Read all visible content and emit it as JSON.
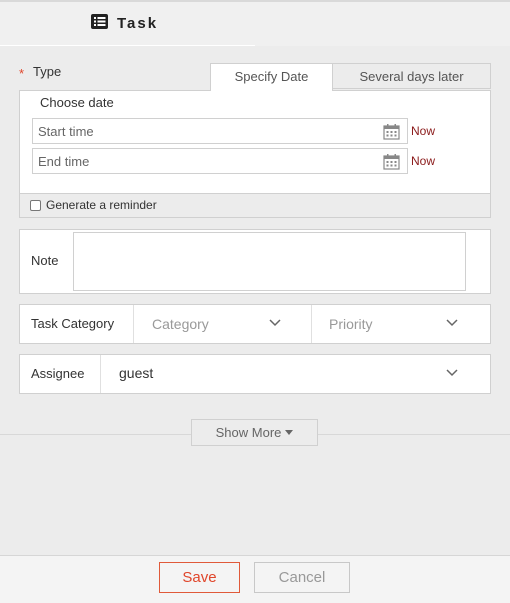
{
  "dialog": {
    "title": "Task"
  },
  "type_field": {
    "required_mark": "*",
    "label": "Type",
    "tabs": [
      {
        "label": "Specify Date",
        "active": true
      },
      {
        "label": "Several days later",
        "active": false
      }
    ]
  },
  "date_panel": {
    "heading": "Choose date",
    "start_placeholder": "Start time",
    "end_placeholder": "End time",
    "now_label": "Now"
  },
  "reminder": {
    "label": "Generate a reminder",
    "checked": false
  },
  "note": {
    "label": "Note",
    "value": ""
  },
  "task_category": {
    "label": "Task Category",
    "category_placeholder": "Category",
    "priority_placeholder": "Priority"
  },
  "assignee": {
    "label": "Assignee",
    "value": "guest"
  },
  "show_more": {
    "label": "Show More"
  },
  "footer": {
    "save_label": "Save",
    "cancel_label": "Cancel"
  },
  "colors": {
    "accent": "#e0452a",
    "now_link": "#8b1a1a"
  }
}
